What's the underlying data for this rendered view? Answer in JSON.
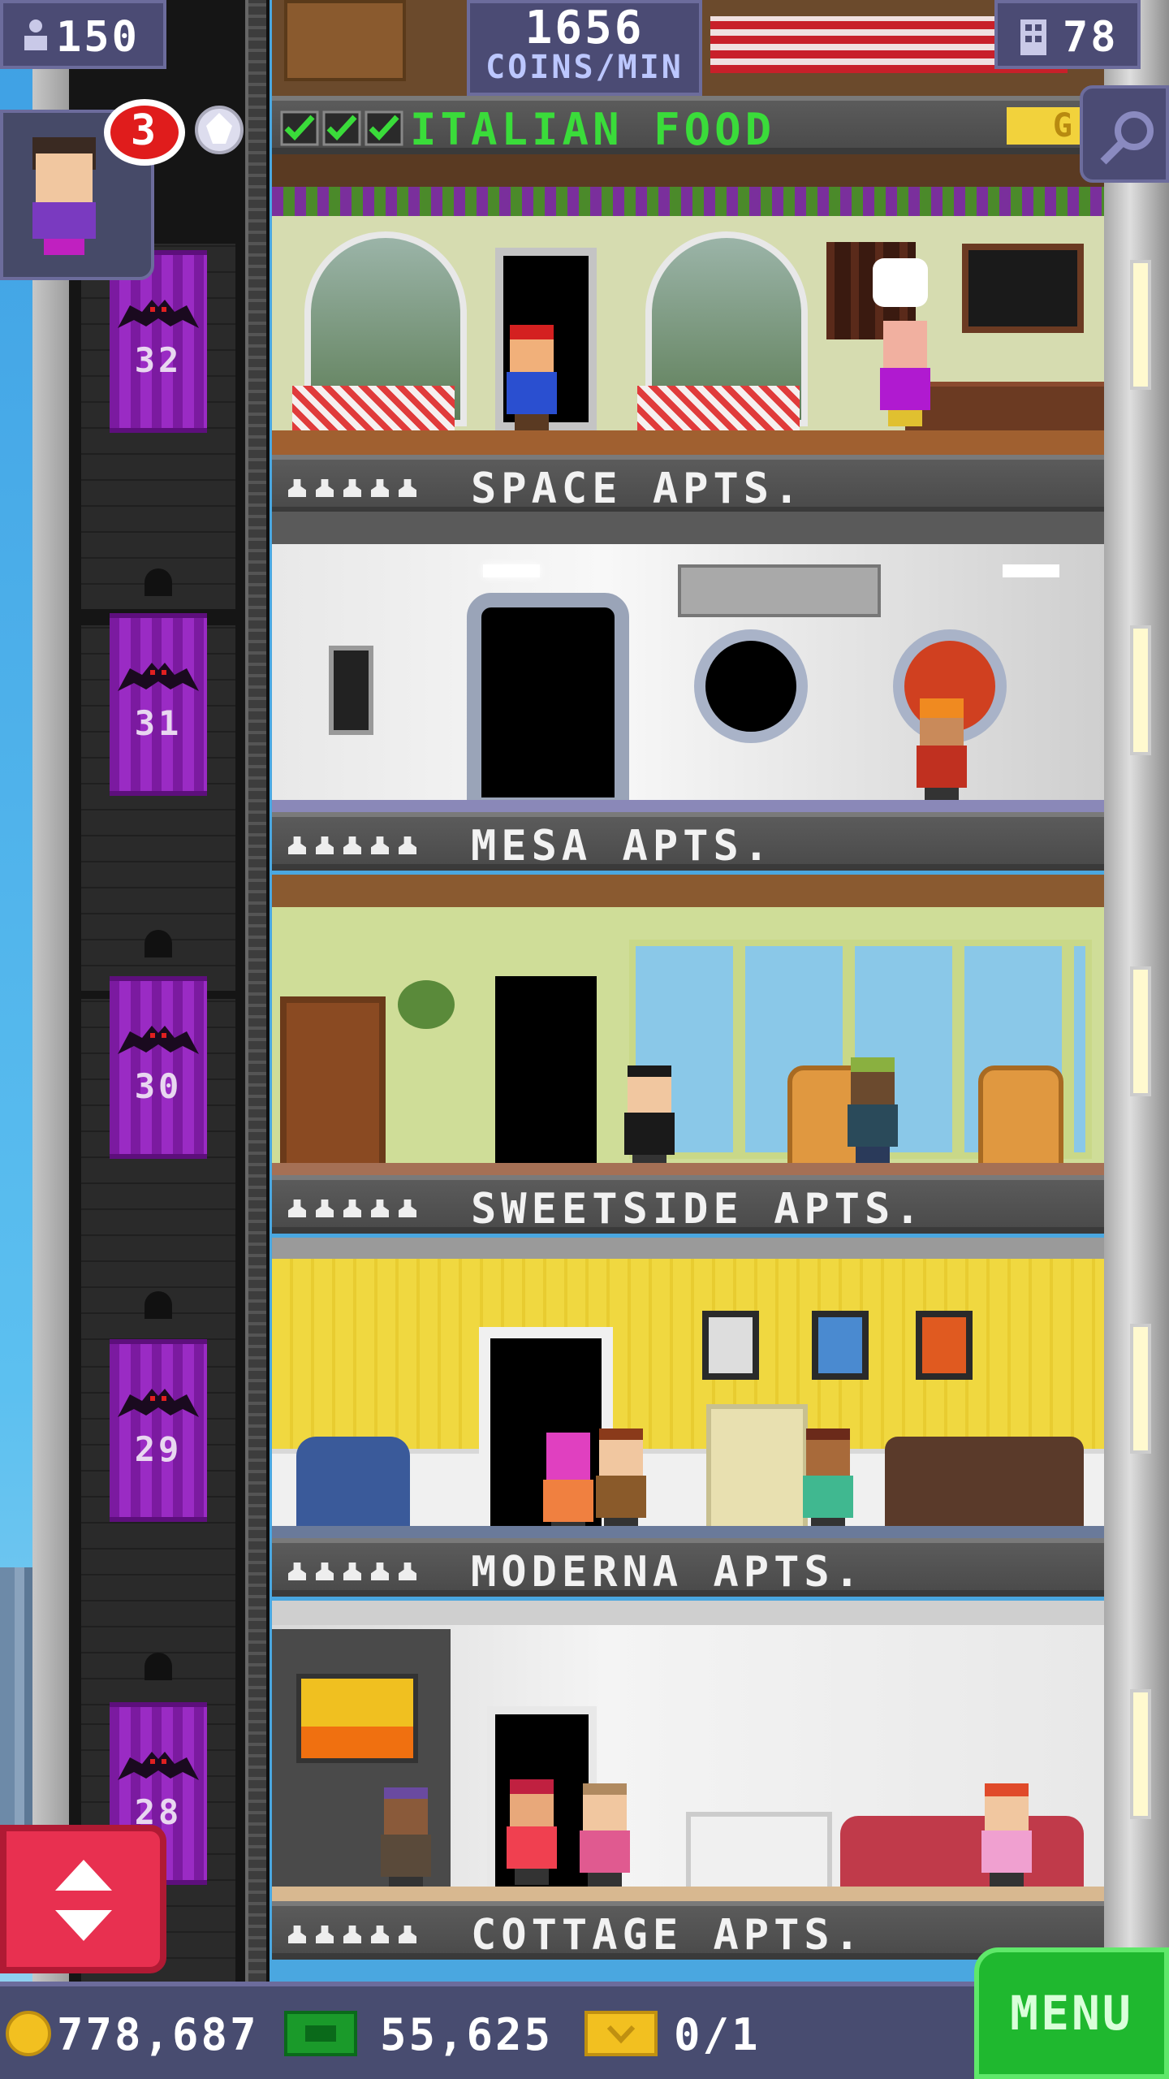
{
  "hud": {
    "population": "150",
    "coins_per_min_value": "1656",
    "coins_per_min_label": "COINS/MIN",
    "floor_count": "78",
    "notification_count": "3"
  },
  "top_floor": {
    "name": "ITALIAN FOOD",
    "stocked_checks": 3,
    "badge_text": "G"
  },
  "floors": [
    {
      "elevator_number": "32",
      "name": "SPACE APTS."
    },
    {
      "elevator_number": "31",
      "name": "MESA APTS."
    },
    {
      "elevator_number": "30",
      "name": "SWEETSIDE APTS."
    },
    {
      "elevator_number": "29",
      "name": "MODERNA APTS."
    },
    {
      "elevator_number": "28",
      "name": "COTTAGE APTS."
    }
  ],
  "bottom_bar": {
    "coins": "778,687",
    "bux": "55,625",
    "tickets": "0/1",
    "menu_label": "MENU"
  },
  "colors": {
    "elevator_purple": "#8b22b4",
    "menu_green": "#1fb82f",
    "hud_panel": "#4b4b74",
    "badge_red": "#e01c1c"
  }
}
